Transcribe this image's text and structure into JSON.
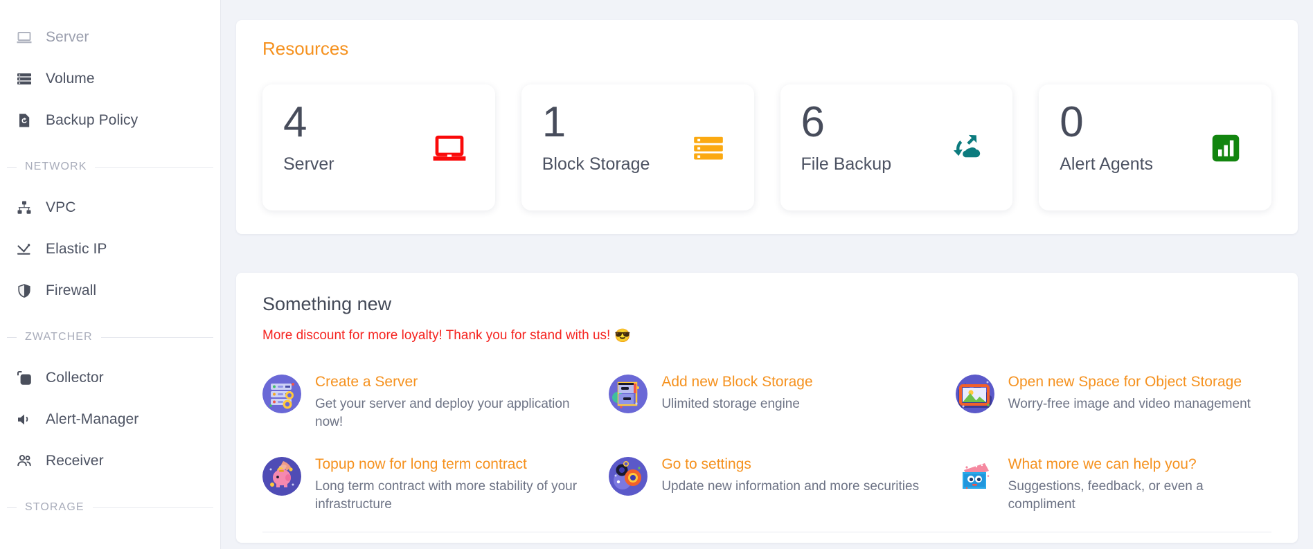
{
  "sidebar": {
    "items": [
      {
        "label": "Server",
        "icon": "laptop-icon",
        "muted": true
      },
      {
        "label": "Volume",
        "icon": "storage-stack-icon",
        "muted": false
      },
      {
        "label": "Backup Policy",
        "icon": "file-restore-icon",
        "muted": false
      }
    ],
    "sections": [
      {
        "title": "NETWORK",
        "items": [
          {
            "label": "VPC",
            "icon": "network-tree-icon"
          },
          {
            "label": "Elastic IP",
            "icon": "elastic-ip-icon"
          },
          {
            "label": "Firewall",
            "icon": "shield-icon"
          }
        ]
      },
      {
        "title": "ZWATCHER",
        "items": [
          {
            "label": "Collector",
            "icon": "copy-layers-icon"
          },
          {
            "label": "Alert-Manager",
            "icon": "speaker-icon"
          },
          {
            "label": "Receiver",
            "icon": "users-icon"
          }
        ]
      },
      {
        "title": "STORAGE",
        "items": []
      }
    ]
  },
  "resources": {
    "title": "Resources",
    "cards": [
      {
        "value": "4",
        "label": "Server",
        "icon": "laptop-red-icon",
        "color": "#fa0a0a"
      },
      {
        "value": "1",
        "label": "Block Storage",
        "icon": "block-storage-orange-icon",
        "color": "#fba911"
      },
      {
        "value": "6",
        "label": "File Backup",
        "icon": "cloud-backup-teal-icon",
        "color": "#0c7b7e"
      },
      {
        "value": "0",
        "label": "Alert Agents",
        "icon": "bar-chart-green-icon",
        "color": "#12850f"
      }
    ]
  },
  "something_new": {
    "title": "Something new",
    "announcement": "More discount for more loyalty! Thank you for stand with us!",
    "announcement_emoji": "😎",
    "promos": [
      {
        "title": "Create a Server",
        "desc": "Get your server and deploy your application now!",
        "icon": "server-rack-illustration"
      },
      {
        "title": "Add new Block Storage",
        "desc": "Ulimited storage engine",
        "icon": "block-storage-illustration"
      },
      {
        "title": "Open new Space for Object Storage",
        "desc": "Worry-free image and video management",
        "icon": "photo-frame-illustration"
      },
      {
        "title": "Topup now for long term contract",
        "desc": "Long term contract with more stability of your infrastructure",
        "icon": "piggy-bank-illustration"
      },
      {
        "title": "Go to settings",
        "desc": "Update new information and more securities",
        "icon": "gears-illustration"
      },
      {
        "title": "What more we can help you?",
        "desc": "Suggestions, feedback, or even a compliment",
        "icon": "suggestion-box-illustration"
      }
    ]
  },
  "colors": {
    "accent_orange": "#f5911e",
    "announcement_red": "#f5231f",
    "page_bg": "#f1f3f8"
  }
}
